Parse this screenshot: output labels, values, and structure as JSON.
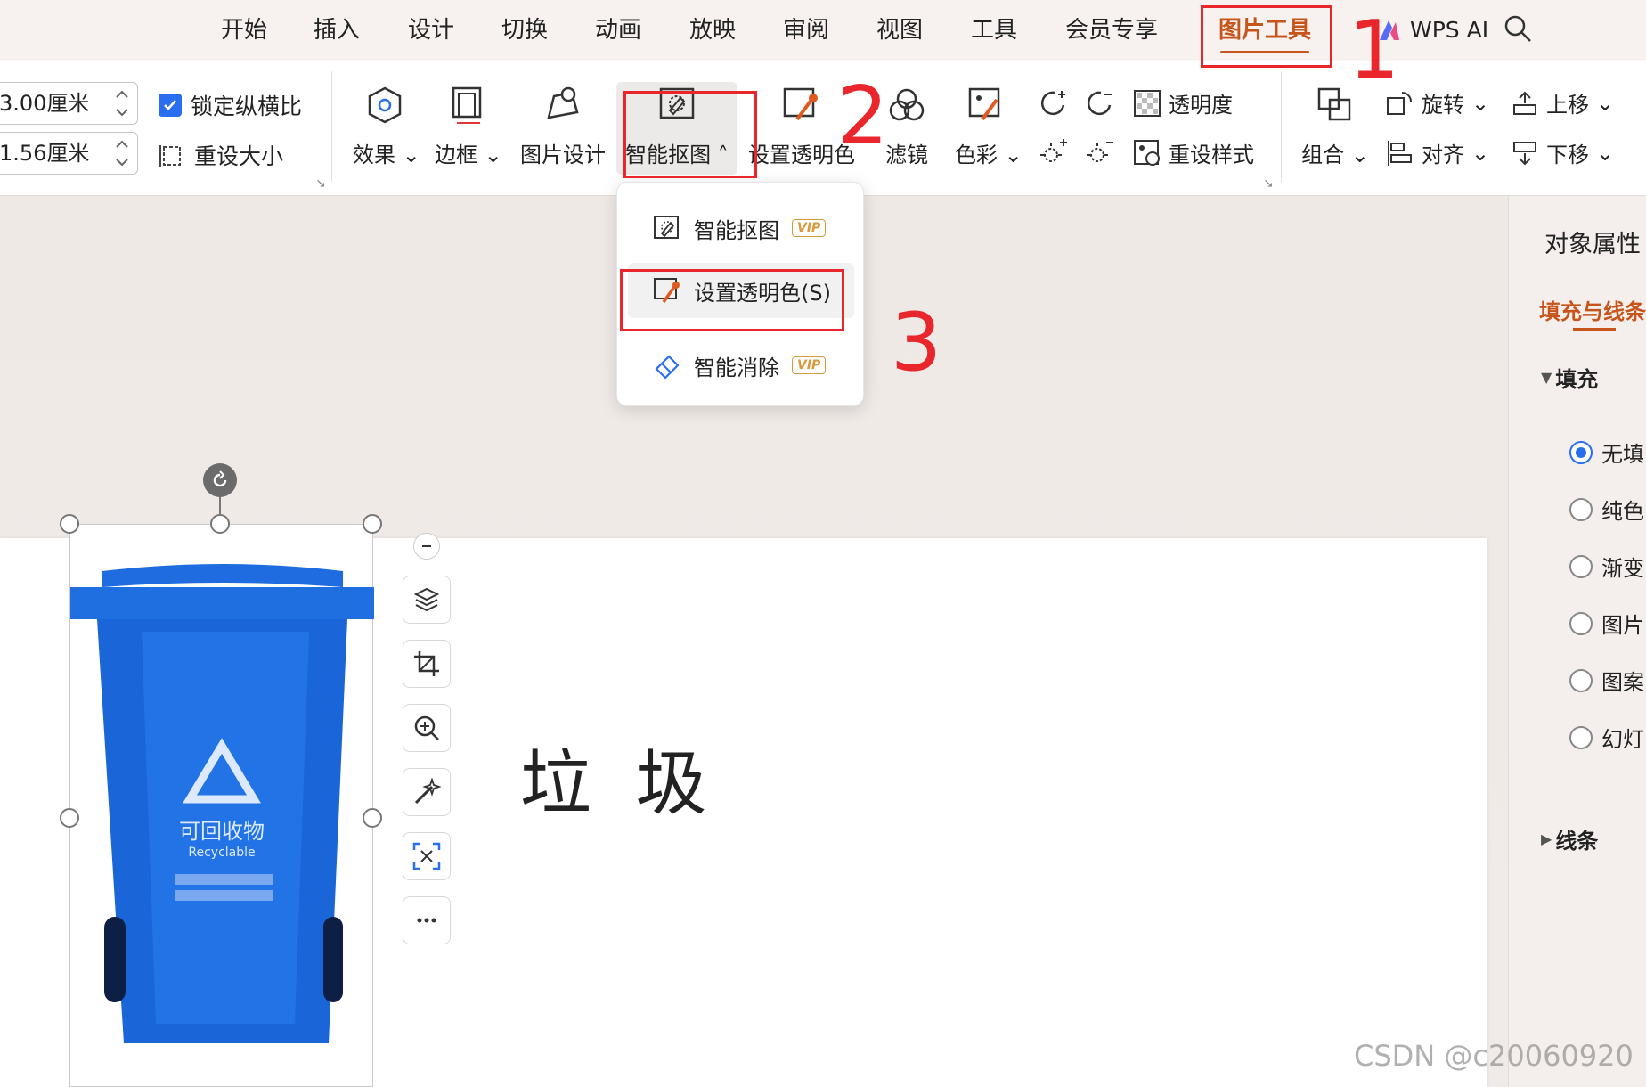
{
  "menu": {
    "tabs": [
      "开始",
      "插入",
      "设计",
      "切换",
      "动画",
      "放映",
      "审阅",
      "视图",
      "工具",
      "会员专享"
    ],
    "active_tab": "图片工具",
    "wps_ai": "WPS AI"
  },
  "ribbon": {
    "width_value": "3.00厘米",
    "height_value": "1.56厘米",
    "lock_ratio": "锁定纵横比",
    "reset_size": "重设大小",
    "effect": "效果",
    "border": "边框",
    "picture_design": "图片设计",
    "smart_cutout": "智能抠图",
    "set_transparent": "设置透明色",
    "filter": "滤镜",
    "color": "色彩",
    "transparency": "透明度",
    "reset_style": "重设样式",
    "group": "组合",
    "rotate": "旋转",
    "align": "对齐",
    "move_up": "上移",
    "move_down": "下移"
  },
  "dropdown": {
    "items": [
      {
        "label": "智能抠图",
        "badge": "VIP"
      },
      {
        "label": "设置透明色(S)",
        "badge": ""
      },
      {
        "label": "智能消除",
        "badge": "VIP"
      }
    ]
  },
  "slide": {
    "text": "垃 圾"
  },
  "image": {
    "bin_label_cn": "可回收物",
    "bin_label_en": "Recyclable"
  },
  "pane": {
    "title": "对象属性",
    "tab": "填充与线条",
    "fill_section": "填充",
    "line_section": "线条",
    "fill_options": [
      "无填",
      "纯色",
      "渐变",
      "图片",
      "图案",
      "幻灯"
    ],
    "selected_option": "无填"
  },
  "annotations": {
    "n1": "1",
    "n2": "2",
    "n3": "3"
  },
  "watermark": "CSDN @c20060920",
  "colors": {
    "accent": "#c7541a",
    "annotation_red": "#e8262c",
    "checkbox_blue": "#2a6ef0",
    "bin_blue": "#1f6fe0"
  }
}
